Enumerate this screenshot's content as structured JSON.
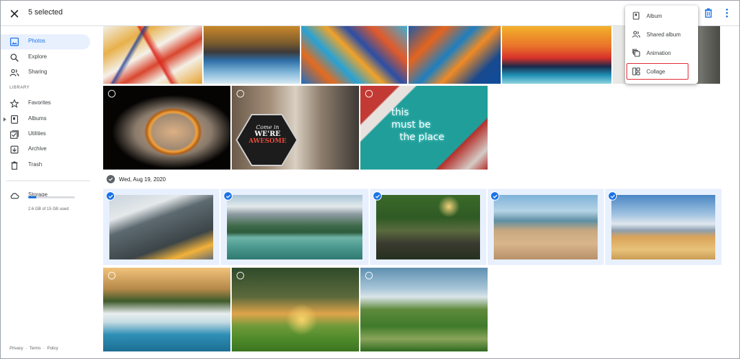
{
  "header": {
    "close_icon": "close-icon",
    "selection_count": "5 selected",
    "delete_icon": "trash-icon",
    "more_icon": "more-vert-icon"
  },
  "sidebar": {
    "items": [
      {
        "label": "Photos",
        "icon": "photo-icon",
        "active": true
      },
      {
        "label": "Explore",
        "icon": "search-icon"
      },
      {
        "label": "Sharing",
        "icon": "people-icon"
      }
    ],
    "library_label": "LIBRARY",
    "library_items": [
      {
        "label": "Favorites",
        "icon": "star-icon"
      },
      {
        "label": "Albums",
        "icon": "album-icon"
      },
      {
        "label": "Utilities",
        "icon": "utilities-icon"
      },
      {
        "label": "Archive",
        "icon": "archive-icon"
      },
      {
        "label": "Trash",
        "icon": "trash-icon"
      }
    ],
    "storage": {
      "label": "Storage",
      "usage": "2.6 GB of 15 GB used",
      "used_fraction": 0.17
    },
    "footer": [
      "Privacy",
      "·",
      "Terms",
      "·",
      "Policy"
    ]
  },
  "grid": {
    "date_header": "Wed, Aug 19, 2020",
    "photo_text": {
      "sign_line1": "Come in",
      "sign_line2": "WE'RE",
      "sign_line3": "AWESOME",
      "neon_line1": "this",
      "neon_line2": "must be",
      "neon_line3": "the place"
    },
    "selected_count": 5
  },
  "create_menu": {
    "items": [
      {
        "label": "Album",
        "icon": "album-icon"
      },
      {
        "label": "Shared album",
        "icon": "shared-album-icon"
      },
      {
        "label": "Animation",
        "icon": "animation-icon"
      },
      {
        "label": "Collage",
        "icon": "collage-icon",
        "highlighted": true
      }
    ],
    "highlight_color": "#e0262f"
  },
  "colors": {
    "accent": "#1a73e8",
    "selected_bg": "#e8f0fe"
  }
}
